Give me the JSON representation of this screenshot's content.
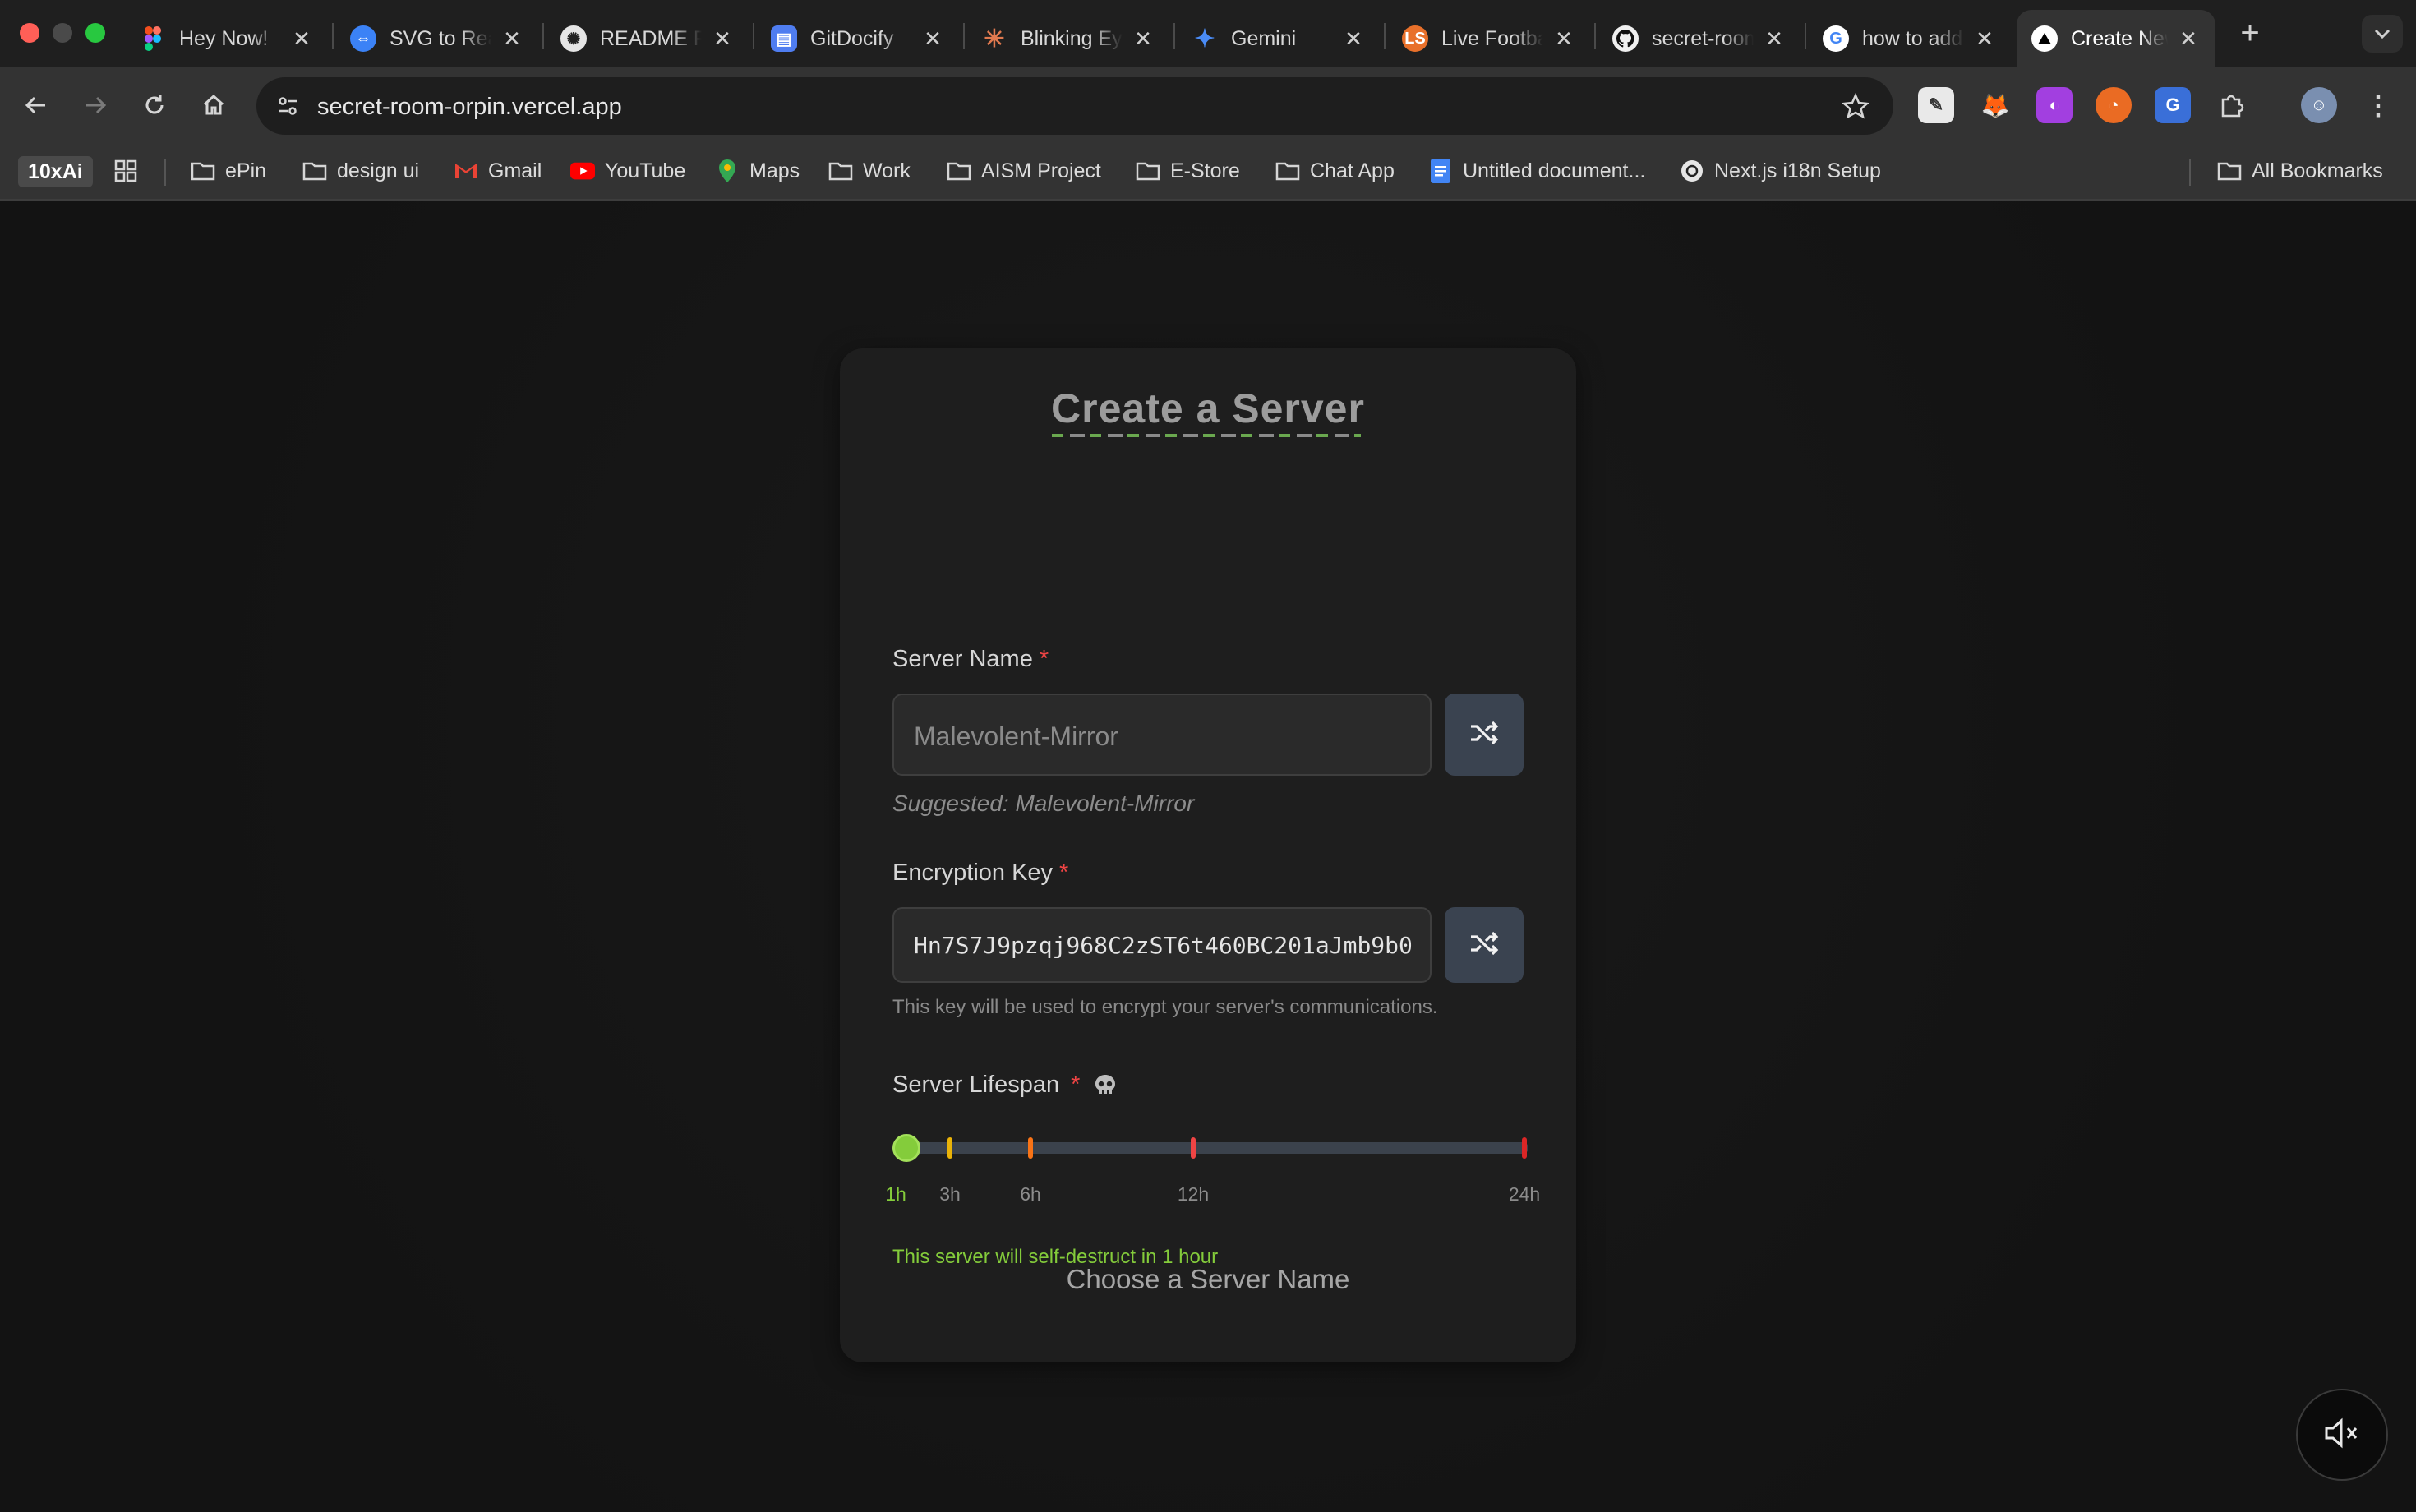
{
  "browser": {
    "tabs": [
      {
        "title": "Hey Now!",
        "favicon": "figma-icon",
        "color": "#a259ff"
      },
      {
        "title": "SVG to React",
        "favicon": "svg-converter-icon",
        "color": "#3b82f6"
      },
      {
        "title": "README Preview",
        "favicon": "openai-icon",
        "color": "#e5e5e5"
      },
      {
        "title": "GitDocify",
        "favicon": "gitdocify-icon",
        "color": "#4f7df0"
      },
      {
        "title": "Blinking Eyes",
        "favicon": "claude-icon",
        "color": "#e0794f"
      },
      {
        "title": "Gemini",
        "favicon": "gemini-icon",
        "color": "#4a8cf7"
      },
      {
        "title": "Live Football",
        "favicon": "livescore-icon",
        "color": "#e8702a"
      },
      {
        "title": "secret-room",
        "favicon": "github-icon",
        "color": "#f0f0f0"
      },
      {
        "title": "how to add",
        "favicon": "google-icon",
        "color": "#ffffff"
      },
      {
        "title": "Create New",
        "favicon": "vercel-icon",
        "color": "#ffffff",
        "active": true
      }
    ],
    "url": "secret-room-orpin.vercel.app",
    "bookmarks": [
      {
        "label": "10xAi"
      },
      {
        "label": "ePin",
        "icon": "folder-icon"
      },
      {
        "label": "design ui",
        "icon": "folder-icon"
      },
      {
        "label": "Gmail",
        "icon": "gmail-icon"
      },
      {
        "label": "YouTube",
        "icon": "youtube-icon"
      },
      {
        "label": "Maps",
        "icon": "maps-icon"
      },
      {
        "label": "Work",
        "icon": "folder-icon"
      },
      {
        "label": "AISM Project",
        "icon": "folder-icon"
      },
      {
        "label": "E-Store",
        "icon": "folder-icon"
      },
      {
        "label": "Chat App",
        "icon": "folder-icon"
      },
      {
        "label": "Untitled document...",
        "icon": "google-docs-icon"
      },
      {
        "label": "Next.js i18n Setup",
        "icon": "openai-icon"
      },
      {
        "label": "All Bookmarks",
        "icon": "folder-icon"
      }
    ]
  },
  "form": {
    "title": "Create a Server",
    "server_name": {
      "label": "Server Name",
      "required": "*",
      "placeholder": "Malevolent-Mirror",
      "suggested": "Suggested: Malevolent-Mirror"
    },
    "encryption_key": {
      "label": "Encryption Key",
      "required": "*",
      "value": "Hn7S7J9pzqj968C2zST6t460BC201aJmb9b0",
      "hint": "This key will be used to encrypt your server's communications."
    },
    "lifespan": {
      "label": "Server Lifespan",
      "required": "*",
      "icon": "skull-icon",
      "options": [
        "1h",
        "3h",
        "6h",
        "12h",
        "24h"
      ],
      "selected_index": 0,
      "tick_colors": [
        "#84cc3b",
        "#eab308",
        "#f97316",
        "#ef4444",
        "#dc2626"
      ],
      "status": "This server will self-destruct in 1 hour"
    },
    "submit_label": "Choose a Server Name"
  },
  "colors": {
    "accent_green": "#84cc3b",
    "required_red": "#ef4444",
    "card_bg": "#1e1e1e"
  }
}
